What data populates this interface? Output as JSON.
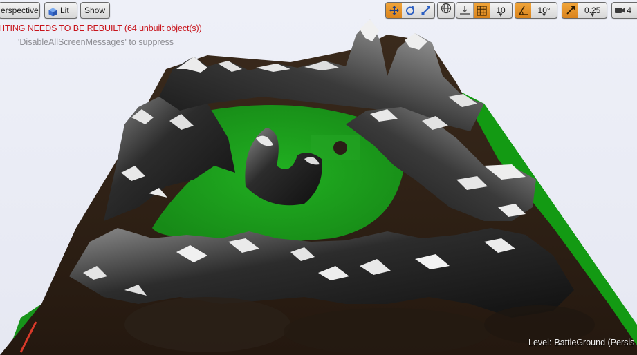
{
  "viewport": {
    "view_mode_label": "erspective",
    "lighting_label": "Lit",
    "show_label": "Show"
  },
  "toolbar": {
    "transform_tools": [
      "translate-icon",
      "rotate-icon",
      "scale-icon"
    ],
    "coordinate_space_icon": "globe-icon",
    "surface_snap_icon": "surface-snap-icon",
    "grid_snap_icon": "grid-icon",
    "grid_snap_value": "10",
    "rotation_snap_icon": "angle-icon",
    "rotation_snap_value": "10°",
    "scale_snap_icon": "scale-snap-icon",
    "scale_snap_value": "0.25",
    "camera_speed_icon": "camera-speed-icon",
    "camera_speed_value": "4"
  },
  "messages": {
    "warning": "HTING NEEDS TO BE REBUILT (64 unbuilt object(s))",
    "suppress_hint": "'DisableAllScreenMessages' to suppress"
  },
  "level": {
    "label": "Level:",
    "value": "BattleGround (Persis"
  },
  "colors": {
    "accent_active": "#e08e26",
    "warning_text": "#c8141c",
    "terrain_green": "#1fa21f",
    "terrain_dark": "#2a1e14"
  }
}
